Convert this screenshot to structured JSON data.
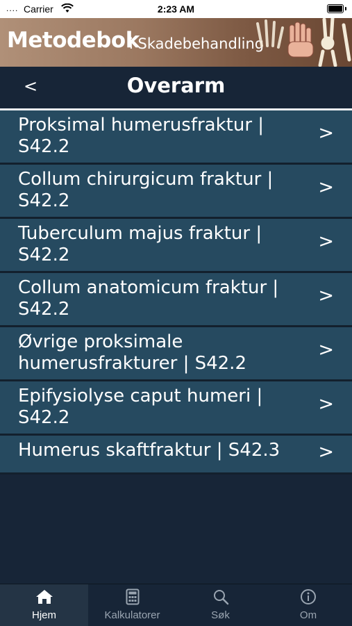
{
  "status_bar": {
    "signal": "....",
    "carrier": "Carrier",
    "time": "2:23 AM"
  },
  "banner": {
    "title": "Metodebok",
    "subtitle": "i Skadebehandling"
  },
  "navbar": {
    "back_label": "<",
    "title": "Overarm"
  },
  "list": {
    "chevron": ">",
    "items": [
      {
        "label": "Proksimal humerusfraktur | S42.2"
      },
      {
        "label": "Collum chirurgicum fraktur | S42.2"
      },
      {
        "label": "Tuberculum majus fraktur | S42.2"
      },
      {
        "label": "Collum anatomicum fraktur | S42.2"
      },
      {
        "label": "Øvrige proksimale humerusfrakturer | S42.2"
      },
      {
        "label": "Epifysiolyse caput humeri | S42.2"
      },
      {
        "label": "Humerus skaftfraktur | S42.3"
      }
    ]
  },
  "tabs": [
    {
      "label": "Hjem",
      "icon": "home-icon",
      "active": true
    },
    {
      "label": "Kalkulatorer",
      "icon": "calculator-icon",
      "active": false
    },
    {
      "label": "Søk",
      "icon": "search-icon",
      "active": false
    },
    {
      "label": "Om",
      "icon": "info-icon",
      "active": false
    }
  ],
  "colors": {
    "background": "#172537",
    "row": "#264a60",
    "active_tab": "#243445"
  }
}
